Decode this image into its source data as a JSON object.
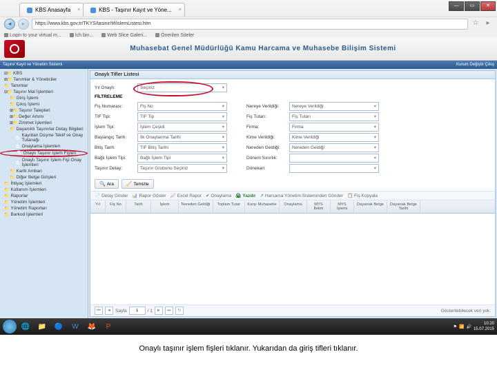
{
  "browser": {
    "tabs": [
      "KBS Anasayfa",
      "KBS - Taşınır Kayıt ve Yöne..."
    ],
    "url": "https://www.kbs.gov.tr/TKYS/tasinir/tif/islemListesi.htm",
    "bookmarks": [
      "Login to your virtual m...",
      "İch bin...",
      "Web Slice Galeri...",
      "Önerilen Siteler"
    ]
  },
  "site": {
    "title": "Muhasebat Genel Müdürlüğü Kamu Harcama ve Muhasebe Bilişim Sistemi",
    "barLeft": "Taşınır Kayıt ve Yönetim Sistemi",
    "barRight": "Kurum Değiştir   Çıkış"
  },
  "tree": [
    {
      "l": 1,
      "t": "KBS",
      "c": "collapse"
    },
    {
      "l": 1,
      "t": "Tanımlar & Yöneticiler",
      "c": "expand"
    },
    {
      "l": 1,
      "t": "Tanımlar",
      "c": "folder"
    },
    {
      "l": 1,
      "t": "Taşınır Mal İşlemleri",
      "c": "collapse"
    },
    {
      "l": 2,
      "t": "Giriş İşlemi",
      "c": "folder"
    },
    {
      "l": 2,
      "t": "Çıkış İşlemi",
      "c": "folder"
    },
    {
      "l": 2,
      "t": "Taşınır Talepleri",
      "c": "expand"
    },
    {
      "l": 2,
      "t": "Değer Artımı",
      "c": "expand"
    },
    {
      "l": 2,
      "t": "Zimmet İşlemleri",
      "c": "expand"
    },
    {
      "l": 2,
      "t": "Dayanıklı Taşınırlar Detay Bilgileri",
      "c": "folder"
    },
    {
      "l": 3,
      "t": "Kayıttan Düşme Teklif ve Onay Tutanağı",
      "c": "doc"
    },
    {
      "l": 3,
      "t": "Onaylama İşlemleri",
      "c": "doc"
    },
    {
      "l": 3,
      "t": "Onaylı Taşınır İşlem Fişleri",
      "c": "doc",
      "circled": true
    },
    {
      "l": 3,
      "t": "Onaylı Taşınır İşlem Fişi Onay İşlemleri",
      "c": "doc"
    },
    {
      "l": 2,
      "t": "Kartlı Ambarı",
      "c": "folder"
    },
    {
      "l": 2,
      "t": "Diğer Belge Girişleri",
      "c": "folder"
    },
    {
      "l": 1,
      "t": "İhtiyaç İşlemleri",
      "c": "folder"
    },
    {
      "l": 1,
      "t": "Kullanım İşlemleri",
      "c": "folder"
    },
    {
      "l": 1,
      "t": "Raporlar",
      "c": "folder"
    },
    {
      "l": 1,
      "t": "Yönetim İşlemleri",
      "c": "folder"
    },
    {
      "l": 1,
      "t": "Yönetim Raporları",
      "c": "folder"
    },
    {
      "l": 1,
      "t": "Barkod İşlemleri",
      "c": "folder"
    }
  ],
  "panel": {
    "title": "Onaylı Tifler Listesi",
    "yilLabel": "Yıl Onaylı:",
    "yilValue": "Seçiniz",
    "filterTitle": "FİLTRELEME",
    "left": [
      {
        "l": "Fiş Numarası:",
        "v": "Fiş No"
      },
      {
        "l": "TIF Tipi:",
        "v": "TIF Tip"
      },
      {
        "l": "İşlem Tipi:",
        "v": "İşlem Çeşidi"
      },
      {
        "l": "Başlangıç Tarih:",
        "v": "İlk Onaylanma Tarihi"
      },
      {
        "l": "Bitiş Tarih:",
        "v": "TIF Bitiş Tarihi"
      },
      {
        "l": "Bağlı İşlem Tipi:",
        "v": "Bağlı İşlem Tipi"
      },
      {
        "l": "Taşınır Detay:",
        "v": "Taşınır Grubunu Seçiniz"
      }
    ],
    "right": [
      {
        "l": "Nereye Verildiği:",
        "v": "Nereye Verildiği"
      },
      {
        "l": "Fiş Tutarı:",
        "v": "Fiş Tutarı"
      },
      {
        "l": "Firma:",
        "v": "Firma"
      },
      {
        "l": "Kime Verildiği:",
        "v": "Kime Verildiği"
      },
      {
        "l": "Nereden Geldiği:",
        "v": "Nereden Geldiği"
      },
      {
        "l": "Dönem Sınırlık:",
        "v": ""
      },
      {
        "l": "Dönekan:",
        "v": ""
      }
    ],
    "btnSearch": "Ara",
    "btnClear": "Temizle",
    "toolbar": [
      "Detay Göster",
      "Rapor Göster",
      "Excel Rapor",
      "Onaylama",
      "Yazdır",
      "Harcama Yönetim Sisteminden Gönder",
      "Fiş Kopyala"
    ],
    "columns": [
      "Yıl",
      "Fiş No",
      "Tarih",
      "İşlem",
      "Nereden Geldiği",
      "Toplam Tutar",
      "Karşı Muhasebe",
      "Onaylama",
      "MYS İletim",
      "MYS İşlemi",
      "Dayanak Belge",
      "Dayanak Belge Tarihi"
    ],
    "pagerPage": "Sayfa",
    "pagerOf": "/ 1",
    "footerRight": "Gösterilebilecek veri yok."
  },
  "taskbar": {
    "time": "10:20",
    "date": "15.07.2015"
  },
  "caption": "Onaylı taşınır işlem fişleri tıklanır. Yukarıdan da giriş tifleri tıklanır."
}
